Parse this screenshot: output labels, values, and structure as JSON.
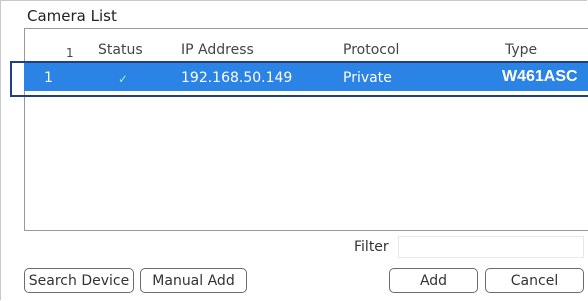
{
  "window": {
    "title": "Camera List"
  },
  "table": {
    "columns": {
      "index": "1",
      "status": "Status",
      "ip": "IP Address",
      "protocol": "Protocol",
      "type": "Type"
    },
    "rows": [
      {
        "index": "1",
        "status": "✓",
        "ip": "192.168.50.149",
        "protocol": "Private",
        "type": "W461ASC",
        "selected": true
      }
    ]
  },
  "filter": {
    "label": "Filter",
    "value": ""
  },
  "buttons": {
    "search": "Search Device",
    "manual": "Manual Add",
    "add": "Add",
    "cancel": "Cancel"
  },
  "colors": {
    "selection": "#2b83e6",
    "outline": "#1f3e86",
    "status_ok": "#9ef0b2"
  }
}
